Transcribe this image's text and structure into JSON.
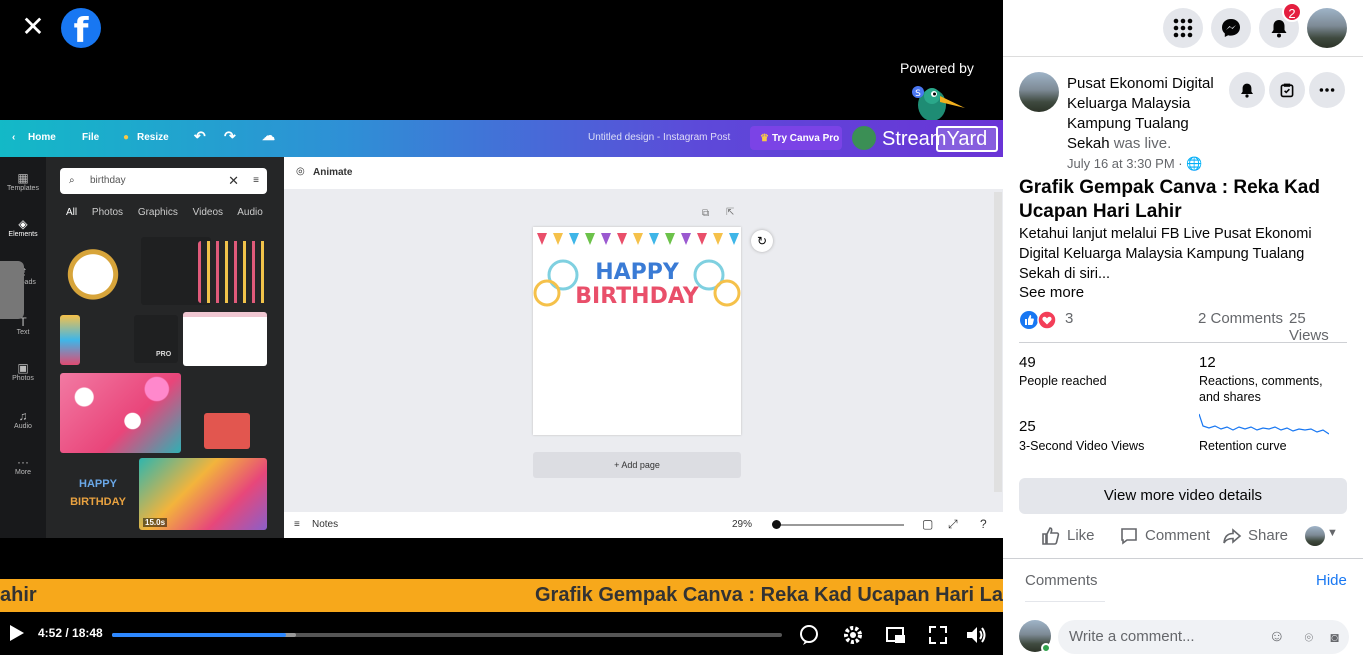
{
  "video": {
    "powered_by": "Powered by",
    "ticker_text_left": "ahir",
    "ticker_text_right": "Grafik Gempak Canva : Reka Kad Ucapan Hari Lah",
    "time": "4:52 / 18:48",
    "progress": 0.259
  },
  "canva": {
    "home": "Home",
    "file": "File",
    "resize": "Resize",
    "design_title": "Untitled design - Instagram Post",
    "try_pro": "Try Canva Pro",
    "streamyard": "StreamYard",
    "search_value": "birthday",
    "tabs": [
      "All",
      "Photos",
      "Graphics",
      "Videos",
      "Audio"
    ],
    "left_items": [
      "Templates",
      "Elements",
      "Uploads",
      "Text",
      "Photos",
      "Audio",
      "More"
    ],
    "animate": "Animate",
    "add_page": "+ Add page",
    "notes": "Notes",
    "zoom": "29%",
    "happy": "HAPPY",
    "birthday": "BIRTHDAY",
    "tile_happy": "HAPPY",
    "tile_birthday": "BIRTHDAY",
    "pro": "PRO",
    "duration": "15.0s"
  },
  "post": {
    "page_name": "Pusat Ekonomi Digital Keluarga Malaysia Kampung Tualang Sekah",
    "was_live": "was live.",
    "date": "July 16 at 3:30 PM · ",
    "title": "Grafik Gempak Canva : Reka Kad Ucapan Hari Lahir",
    "description": "Ketahui lanjut melalui FB Live Pusat Ekonomi Digital Keluarga Malaysia Kampung Tualang Sekah di siri...",
    "see_more": "See more",
    "reaction_count": "3",
    "comments_count": "2 Comments",
    "views": "25 Views"
  },
  "notifications": {
    "badge": "2"
  },
  "stats": {
    "people_reached_num": "49",
    "people_reached_label": "People reached",
    "reactions_num": "12",
    "reactions_label": "Reactions, comments, and shares",
    "views_num": "25",
    "views_label": "3-Second Video Views",
    "retention_label": "Retention curve"
  },
  "actions": {
    "view_more": "View more video details",
    "like": "Like",
    "comment": "Comment",
    "share": "Share"
  },
  "comments": {
    "header": "Comments",
    "hide": "Hide",
    "placeholder": "Write a comment..."
  },
  "colors": {
    "fb_blue": "#1877f2",
    "ticker": "#f7a81b",
    "badge": "#e41e3f"
  }
}
